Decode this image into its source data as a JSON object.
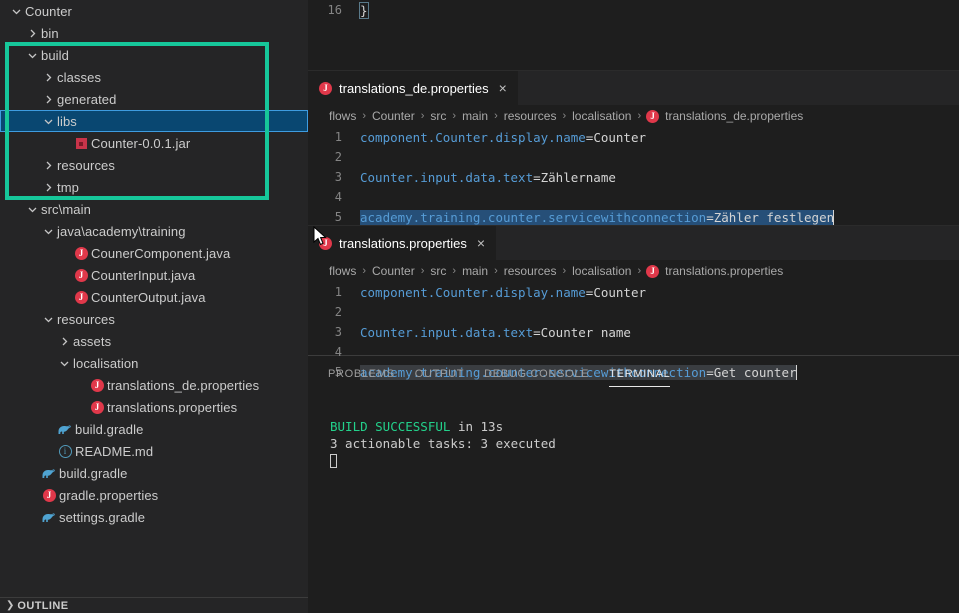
{
  "sidebar": {
    "tree": [
      {
        "indent": 0,
        "twisty": "chevron-down-icon",
        "icon": "none",
        "label": "Counter",
        "name": "tree-item-counter",
        "selected": false
      },
      {
        "indent": 1,
        "twisty": "chevron-right-icon",
        "icon": "none",
        "label": "bin",
        "name": "tree-item-bin",
        "selected": false
      },
      {
        "indent": 1,
        "twisty": "chevron-down-icon",
        "icon": "none",
        "label": "build",
        "name": "tree-item-build",
        "selected": false
      },
      {
        "indent": 2,
        "twisty": "chevron-right-icon",
        "icon": "none",
        "label": "classes",
        "name": "tree-item-classes",
        "selected": false
      },
      {
        "indent": 2,
        "twisty": "chevron-right-icon",
        "icon": "none",
        "label": "generated",
        "name": "tree-item-generated",
        "selected": false
      },
      {
        "indent": 2,
        "twisty": "chevron-down-icon",
        "icon": "none",
        "label": "libs",
        "name": "tree-item-libs",
        "selected": true
      },
      {
        "indent": 3,
        "twisty": "none",
        "icon": "jar-icon",
        "label": "Counter-0.0.1.jar",
        "name": "tree-item-counter-jar",
        "selected": false
      },
      {
        "indent": 2,
        "twisty": "chevron-right-icon",
        "icon": "none",
        "label": "resources",
        "name": "tree-item-build-resources",
        "selected": false
      },
      {
        "indent": 2,
        "twisty": "chevron-right-icon",
        "icon": "none",
        "label": "tmp",
        "name": "tree-item-tmp",
        "selected": false
      },
      {
        "indent": 1,
        "twisty": "chevron-down-icon",
        "icon": "none",
        "label": "src\\main",
        "name": "tree-item-src-main",
        "selected": false
      },
      {
        "indent": 2,
        "twisty": "chevron-down-icon",
        "icon": "none",
        "label": "java\\academy\\training",
        "name": "tree-item-java-academy-training",
        "selected": false
      },
      {
        "indent": 3,
        "twisty": "none",
        "icon": "java-icon",
        "label": "CounerComponent.java",
        "name": "tree-item-counercomponent-java",
        "selected": false
      },
      {
        "indent": 3,
        "twisty": "none",
        "icon": "java-icon",
        "label": "CounterInput.java",
        "name": "tree-item-counterinput-java",
        "selected": false
      },
      {
        "indent": 3,
        "twisty": "none",
        "icon": "java-icon",
        "label": "CounterOutput.java",
        "name": "tree-item-counteroutput-java",
        "selected": false
      },
      {
        "indent": 2,
        "twisty": "chevron-down-icon",
        "icon": "none",
        "label": "resources",
        "name": "tree-item-src-resources",
        "selected": false
      },
      {
        "indent": 3,
        "twisty": "chevron-right-icon",
        "icon": "none",
        "label": "assets",
        "name": "tree-item-assets",
        "selected": false
      },
      {
        "indent": 3,
        "twisty": "chevron-down-icon",
        "icon": "none",
        "label": "localisation",
        "name": "tree-item-localisation",
        "selected": false
      },
      {
        "indent": 4,
        "twisty": "none",
        "icon": "java-icon",
        "label": "translations_de.properties",
        "name": "tree-item-translations-de-properties",
        "selected": false
      },
      {
        "indent": 4,
        "twisty": "none",
        "icon": "java-icon",
        "label": "translations.properties",
        "name": "tree-item-translations-properties",
        "selected": false
      },
      {
        "indent": 2,
        "twisty": "none",
        "icon": "gradle-icon",
        "label": "build.gradle",
        "name": "tree-item-inner-build-gradle",
        "selected": false
      },
      {
        "indent": 2,
        "twisty": "none",
        "icon": "markdown-icon",
        "label": "README.md",
        "name": "tree-item-readme-md",
        "selected": false
      },
      {
        "indent": 1,
        "twisty": "none",
        "icon": "gradle-icon",
        "label": "build.gradle",
        "name": "tree-item-build-gradle",
        "selected": false
      },
      {
        "indent": 1,
        "twisty": "none",
        "icon": "java-icon",
        "label": "gradle.properties",
        "name": "tree-item-gradle-properties",
        "selected": false
      },
      {
        "indent": 1,
        "twisty": "none",
        "icon": "gradle-icon",
        "label": "settings.gradle",
        "name": "tree-item-settings-gradle",
        "selected": false
      }
    ],
    "outline_label": "OUTLINE",
    "annotation_color": "#16c79a",
    "selection_color": "#094771"
  },
  "top_editor": {
    "line_number": "16",
    "code": "}"
  },
  "editor1": {
    "tab_label": "translations_de.properties",
    "tab_close": "×",
    "breadcrumb": [
      "flows",
      "Counter",
      "src",
      "main",
      "resources",
      "localisation",
      "translations_de.properties"
    ],
    "lines": [
      {
        "n": "1",
        "key": "component.Counter.display.name",
        "eq": "=",
        "value": "Counter"
      },
      {
        "n": "2",
        "key": "",
        "eq": "",
        "value": ""
      },
      {
        "n": "3",
        "key": "Counter.input.data.text",
        "eq": "=",
        "value": "Zählername"
      },
      {
        "n": "4",
        "key": "",
        "eq": "",
        "value": ""
      },
      {
        "n": "5",
        "key": "academy.training.counter.servicewithconnection",
        "eq": "=",
        "value": "Zähler festlegen"
      }
    ]
  },
  "editor2": {
    "tab_label": "translations.properties",
    "tab_close": "×",
    "breadcrumb": [
      "flows",
      "Counter",
      "src",
      "main",
      "resources",
      "localisation",
      "translations.properties"
    ],
    "lines": [
      {
        "n": "1",
        "key": "component.Counter.display.name",
        "eq": "=",
        "value": "Counter"
      },
      {
        "n": "2",
        "key": "",
        "eq": "",
        "value": ""
      },
      {
        "n": "3",
        "key": "Counter.input.data.text",
        "eq": "=",
        "value": "Counter name"
      },
      {
        "n": "4",
        "key": "",
        "eq": "",
        "value": ""
      },
      {
        "n": "5",
        "key": "academy.training.counter.servicewithconnection",
        "eq": "=",
        "value": "Get counter"
      }
    ]
  },
  "panel": {
    "tabs": [
      {
        "label": "PROBLEMS",
        "active": false,
        "name": "panel-tab-problems"
      },
      {
        "label": "OUTPUT",
        "active": false,
        "name": "panel-tab-output"
      },
      {
        "label": "DEBUG CONSOLE",
        "active": false,
        "name": "panel-tab-debug-console"
      },
      {
        "label": "TERMINAL",
        "active": true,
        "name": "panel-tab-terminal"
      }
    ],
    "terminal": {
      "status_word": "BUILD SUCCESSFUL",
      "status_rest": " in 13s",
      "tasks_line": "3 actionable tasks: 3 executed",
      "success_color": "#23d18b"
    }
  }
}
